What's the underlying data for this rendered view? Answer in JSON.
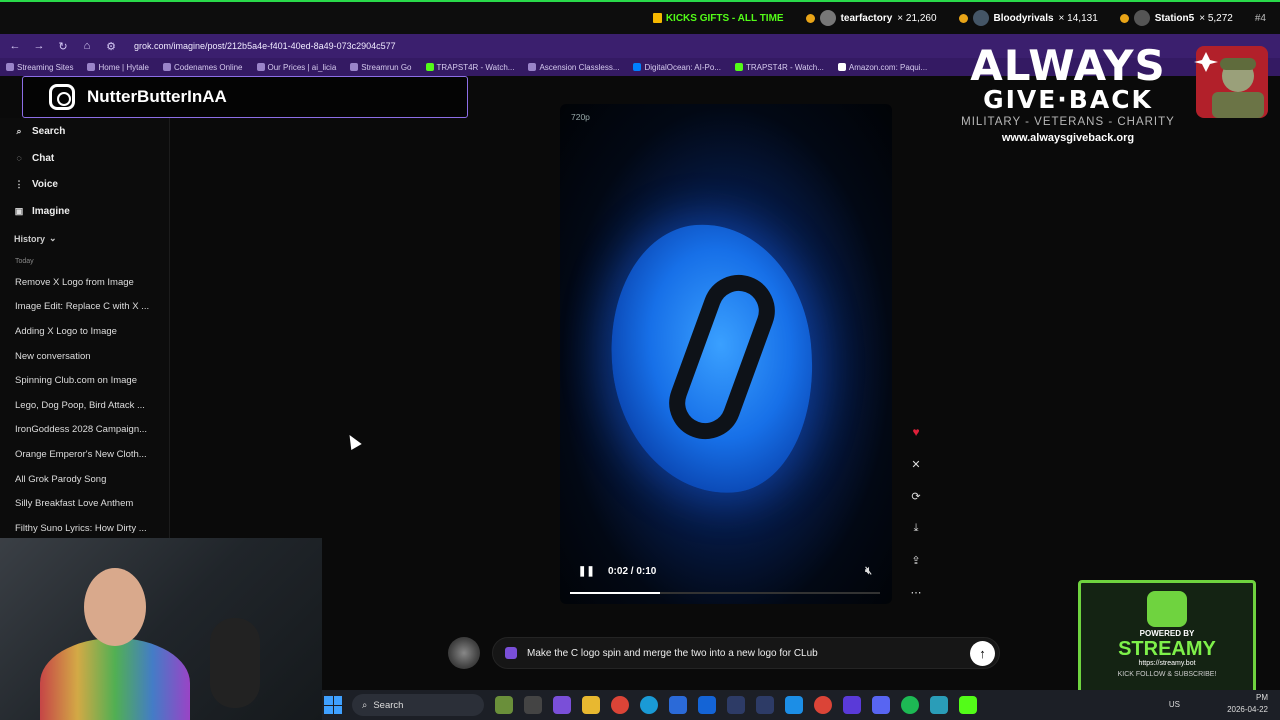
{
  "stream_bar": {
    "kicks_label": "KICKS GIFTS - ALL TIME",
    "donors": [
      {
        "name": "tearfactory",
        "count": "× 21,260"
      },
      {
        "name": "Bloodyrivals",
        "count": "× 14,131"
      },
      {
        "name": "Station5",
        "count": "× 5,272"
      }
    ],
    "rank": "#4",
    "accent": "#53fc18"
  },
  "browser": {
    "url": "grok.com/imagine/post/212b5a4e-f401-40ed-8a49-073c2904c577",
    "bookmarks": [
      "Streaming Sites",
      "Home | Hytale",
      "Codenames Online",
      "Our Prices | ai_licia",
      "Streamrun Go",
      "TRAPST4R - Watch...",
      "Ascension Classless...",
      "DigitalOcean: AI-Po...",
      "TRAPST4R - Watch...",
      "Amazon.com: Paqui..."
    ]
  },
  "instagram": {
    "handle": "NutterButterInAA"
  },
  "sidebar": {
    "nav": [
      {
        "label": "Search",
        "icon": "search-icon"
      },
      {
        "label": "Chat",
        "icon": "chat-icon"
      },
      {
        "label": "Voice",
        "icon": "voice-icon"
      },
      {
        "label": "Imagine",
        "icon": "image-icon"
      }
    ],
    "history_label": "History",
    "today_label": "Today",
    "history": [
      "Remove X Logo from Image",
      "Image Edit: Replace C with X ...",
      "Adding X Logo to Image",
      "New conversation",
      "Spinning Club.com on Image",
      "Lego, Dog Poop, Bird Attack ...",
      "IronGoddess 2028 Campaign...",
      "Orange Emperor's New Cloth...",
      "All Grok Parody Song",
      "Silly Breakfast Love Anthem",
      "Filthy Suno Lyrics: How Dirty ..."
    ]
  },
  "video": {
    "resolution": "720p",
    "time": "0:02 / 0:10",
    "progress": 0.29
  },
  "prompt": {
    "text": "Make the C logo spin and merge the two into a new logo for CLub"
  },
  "brand": {
    "line1": "ALWAYS",
    "line2": "GIVE·BACK",
    "subtitle": "MILITARY - VETERANS - CHARITY",
    "url": "www.alwaysgiveback.org"
  },
  "streamy": {
    "powered": "POWERED BY",
    "name": "STREAMY",
    "url": "https://streamy.bot",
    "footer": "KICK  FOLLOW & SUBSCRIBE!"
  },
  "taskbar": {
    "search_label": "Search",
    "locale": "US",
    "time": "PM",
    "date": "2026-04-22"
  }
}
